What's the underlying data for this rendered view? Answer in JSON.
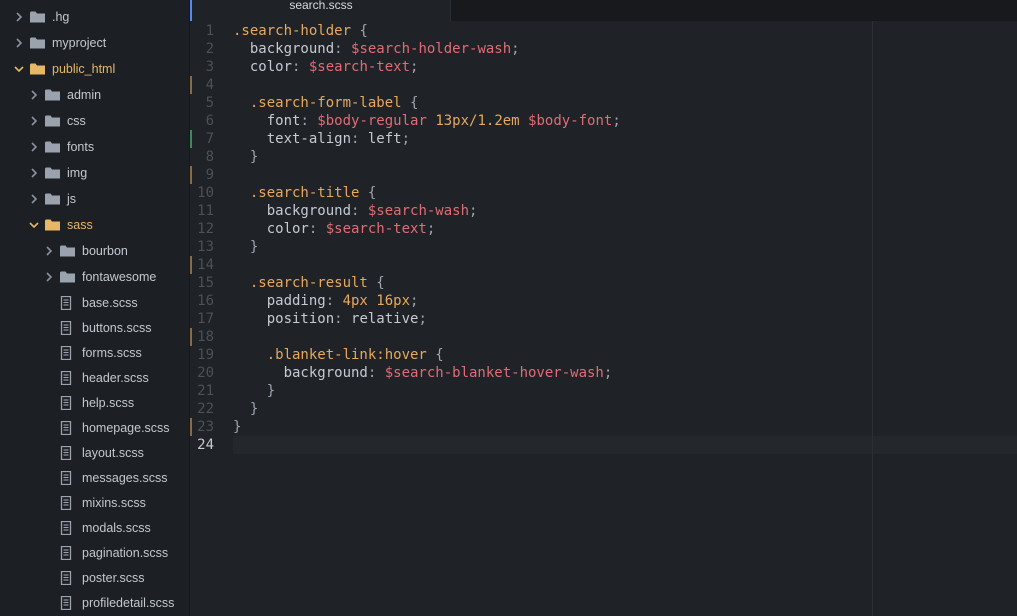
{
  "tree": [
    {
      "label": ".hg",
      "kind": "folder",
      "expanded": false,
      "depth": 0
    },
    {
      "label": "myproject",
      "kind": "folder",
      "expanded": false,
      "depth": 0
    },
    {
      "label": "public_html",
      "kind": "folder",
      "expanded": true,
      "depth": 0
    },
    {
      "label": "admin",
      "kind": "folder",
      "expanded": false,
      "depth": 1
    },
    {
      "label": "css",
      "kind": "folder",
      "expanded": false,
      "depth": 1
    },
    {
      "label": "fonts",
      "kind": "folder",
      "expanded": false,
      "depth": 1
    },
    {
      "label": "img",
      "kind": "folder",
      "expanded": false,
      "depth": 1
    },
    {
      "label": "js",
      "kind": "folder",
      "expanded": false,
      "depth": 1
    },
    {
      "label": "sass",
      "kind": "folder",
      "expanded": true,
      "depth": 1
    },
    {
      "label": "bourbon",
      "kind": "folder",
      "expanded": false,
      "depth": 2
    },
    {
      "label": "fontawesome",
      "kind": "folder",
      "expanded": false,
      "depth": 2
    },
    {
      "label": "base.scss",
      "kind": "file",
      "depth": 2
    },
    {
      "label": "buttons.scss",
      "kind": "file",
      "depth": 2
    },
    {
      "label": "forms.scss",
      "kind": "file",
      "depth": 2
    },
    {
      "label": "header.scss",
      "kind": "file",
      "depth": 2
    },
    {
      "label": "help.scss",
      "kind": "file",
      "depth": 2
    },
    {
      "label": "homepage.scss",
      "kind": "file",
      "depth": 2
    },
    {
      "label": "layout.scss",
      "kind": "file",
      "depth": 2
    },
    {
      "label": "messages.scss",
      "kind": "file",
      "depth": 2
    },
    {
      "label": "mixins.scss",
      "kind": "file",
      "depth": 2
    },
    {
      "label": "modals.scss",
      "kind": "file",
      "depth": 2
    },
    {
      "label": "pagination.scss",
      "kind": "file",
      "depth": 2
    },
    {
      "label": "poster.scss",
      "kind": "file",
      "depth": 2
    },
    {
      "label": "profiledetail.scss",
      "kind": "file",
      "depth": 2
    }
  ],
  "tab": {
    "title": "search.scss"
  },
  "colors": {
    "accent": "#568af2",
    "folder_highlight": "#e7b768",
    "selector": "#e6a95e",
    "variable": "#e06c75",
    "modified_marker": "#8a6b45",
    "added_marker": "#3d8a5c"
  },
  "gutter_markers": {
    "modified": [
      4,
      9,
      14,
      18,
      23
    ],
    "added": [
      7
    ]
  },
  "code_lines": [
    [
      [
        "sel",
        ".search-holder"
      ],
      [
        "punc",
        " {"
      ]
    ],
    [
      [
        "prop",
        "  background"
      ],
      [
        "punc",
        ": "
      ],
      [
        "var",
        "$search-holder-wash"
      ],
      [
        "punc",
        ";"
      ]
    ],
    [
      [
        "prop",
        "  color"
      ],
      [
        "punc",
        ": "
      ],
      [
        "var",
        "$search-text"
      ],
      [
        "punc",
        ";"
      ]
    ],
    [],
    [
      [
        "sel",
        "  .search-form-label"
      ],
      [
        "punc",
        " {"
      ]
    ],
    [
      [
        "prop",
        "    font"
      ],
      [
        "punc",
        ": "
      ],
      [
        "var",
        "$body-regular"
      ],
      [
        "prop",
        " "
      ],
      [
        "num",
        "13px/1.2em"
      ],
      [
        "prop",
        " "
      ],
      [
        "var",
        "$body-font"
      ],
      [
        "punc",
        ";"
      ]
    ],
    [
      [
        "prop",
        "    text-align"
      ],
      [
        "punc",
        ": "
      ],
      [
        "prop",
        "left"
      ],
      [
        "punc",
        ";"
      ]
    ],
    [
      [
        "punc",
        "  }"
      ]
    ],
    [],
    [
      [
        "sel",
        "  .search-title"
      ],
      [
        "punc",
        " {"
      ]
    ],
    [
      [
        "prop",
        "    background"
      ],
      [
        "punc",
        ": "
      ],
      [
        "var",
        "$search-wash"
      ],
      [
        "punc",
        ";"
      ]
    ],
    [
      [
        "prop",
        "    color"
      ],
      [
        "punc",
        ": "
      ],
      [
        "var",
        "$search-text"
      ],
      [
        "punc",
        ";"
      ]
    ],
    [
      [
        "punc",
        "  }"
      ]
    ],
    [],
    [
      [
        "sel",
        "  .search-result"
      ],
      [
        "punc",
        " {"
      ]
    ],
    [
      [
        "prop",
        "    padding"
      ],
      [
        "punc",
        ": "
      ],
      [
        "num",
        "4px 16px"
      ],
      [
        "punc",
        ";"
      ]
    ],
    [
      [
        "prop",
        "    position"
      ],
      [
        "punc",
        ": "
      ],
      [
        "prop",
        "relative"
      ],
      [
        "punc",
        ";"
      ]
    ],
    [],
    [
      [
        "sel",
        "    .blanket-link:hover"
      ],
      [
        "punc",
        " {"
      ]
    ],
    [
      [
        "prop",
        "      background"
      ],
      [
        "punc",
        ": "
      ],
      [
        "var",
        "$search-blanket-hover-wash"
      ],
      [
        "punc",
        ";"
      ]
    ],
    [
      [
        "punc",
        "    }"
      ]
    ],
    [
      [
        "punc",
        "  }"
      ]
    ],
    [
      [
        "punc",
        "}"
      ]
    ],
    []
  ]
}
